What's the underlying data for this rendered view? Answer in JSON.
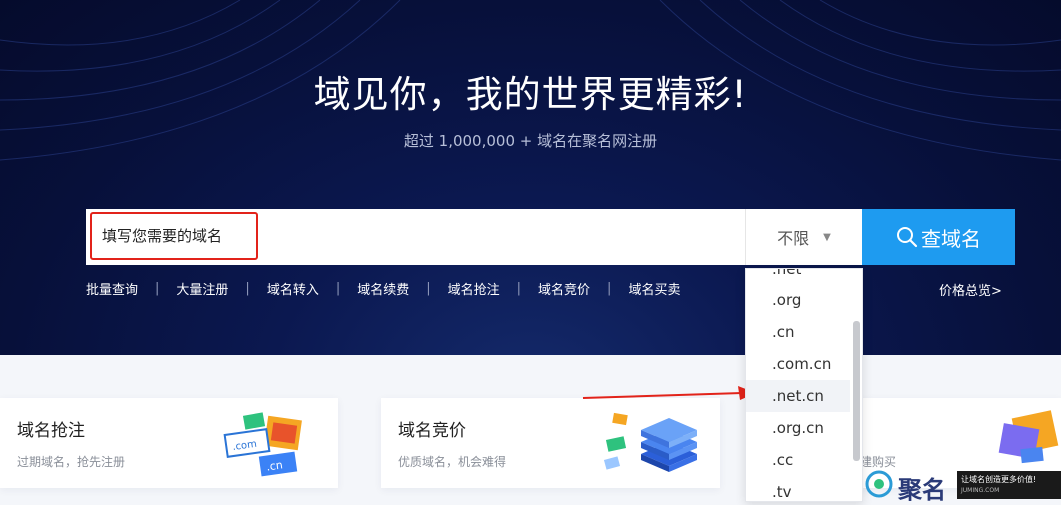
{
  "hero": {
    "title": "域见你，我的世界更精彩!",
    "subtitle": "超过 1,000,000 + 域名在聚名网注册"
  },
  "search": {
    "placeholder": "填写您需要的域名",
    "suffix_selected": "不限",
    "button_label": "查域名"
  },
  "quick_links": [
    "批量查询",
    "大量注册",
    "域名转入",
    "域名续费",
    "域名抢注",
    "域名竞价",
    "域名买卖"
  ],
  "price_link": "价格总览>",
  "dropdown": {
    "items": [
      ".net",
      ".org",
      ".cn",
      ".com.cn",
      ".net.cn",
      ".org.cn",
      ".cc",
      ".tv"
    ],
    "highlighted": ".net.cn"
  },
  "cards": [
    {
      "title": "域名抢注",
      "desc": "过期域名，抢先注册"
    },
    {
      "title": "域名竞价",
      "desc": "优质域名，机会难得"
    },
    {
      "title": "",
      "desc": "建购买"
    }
  ],
  "watermark": {
    "logo_text": "聚名",
    "slogan": "让域名创造更多价值!",
    "domain": "JUMING.COM"
  },
  "colors": {
    "hero_bg": "#0b1850",
    "accent_blue": "#1e9bf0",
    "highlight_red": "#e2231a"
  }
}
